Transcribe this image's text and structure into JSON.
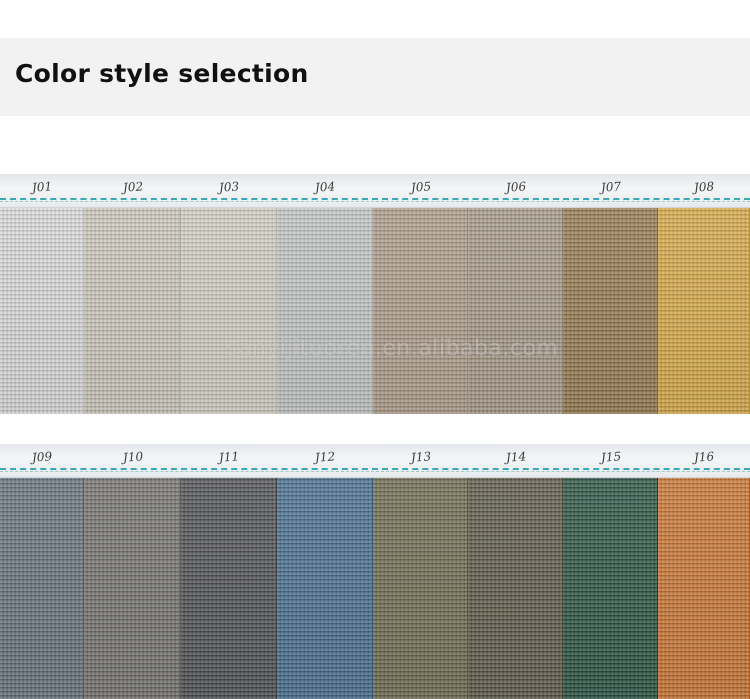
{
  "header": {
    "title": "Color style selection"
  },
  "watermark": {
    "text": "sanyijituoren.en.alibaba.com"
  },
  "rows": [
    {
      "swatches": [
        {
          "code": "J01",
          "color": "#d6d7d6"
        },
        {
          "code": "J02",
          "color": "#c9c4b8"
        },
        {
          "code": "J03",
          "color": "#cfccbf"
        },
        {
          "code": "J04",
          "color": "#bfc2c1"
        },
        {
          "code": "J05",
          "color": "#a99885"
        },
        {
          "code": "J06",
          "color": "#a09481"
        },
        {
          "code": "J07",
          "color": "#8f7448"
        },
        {
          "code": "J08",
          "color": "#d4a43e"
        }
      ]
    },
    {
      "swatches": [
        {
          "code": "J09",
          "color": "#5e6a73"
        },
        {
          "code": "J10",
          "color": "#6c6b68"
        },
        {
          "code": "J11",
          "color": "#45474a"
        },
        {
          "code": "J12",
          "color": "#3f6688"
        },
        {
          "code": "J13",
          "color": "#676448"
        },
        {
          "code": "J14",
          "color": "#55513f"
        },
        {
          "code": "J15",
          "color": "#1f4a39"
        },
        {
          "code": "J16",
          "color": "#c66d28"
        }
      ]
    }
  ]
}
